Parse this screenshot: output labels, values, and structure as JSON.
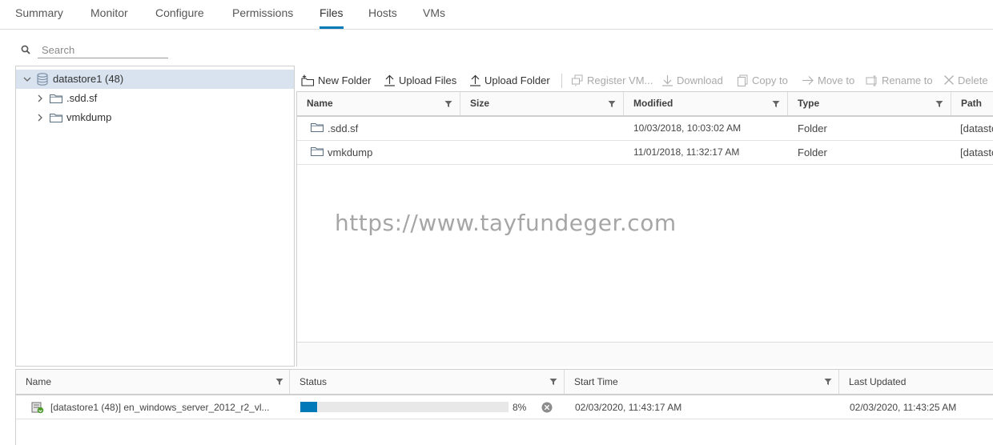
{
  "tabs": [
    {
      "label": "Summary",
      "active": false
    },
    {
      "label": "Monitor",
      "active": false
    },
    {
      "label": "Configure",
      "active": false
    },
    {
      "label": "Permissions",
      "active": false
    },
    {
      "label": "Files",
      "active": true
    },
    {
      "label": "Hosts",
      "active": false
    },
    {
      "label": "VMs",
      "active": false
    }
  ],
  "search": {
    "placeholder": "Search",
    "value": ""
  },
  "tree": {
    "root": {
      "label": "datastore1 (48)",
      "expanded": true,
      "selected": true,
      "icon": "datastore-icon"
    },
    "children": [
      {
        "label": ".sdd.sf",
        "icon": "folder-icon"
      },
      {
        "label": "vmkdump",
        "icon": "folder-icon"
      }
    ]
  },
  "toolbar": {
    "new_folder": "New Folder",
    "upload_files": "Upload Files",
    "upload_folder": "Upload Folder",
    "register_vm": "Register VM...",
    "download": "Download",
    "copy_to": "Copy to",
    "move_to": "Move to",
    "rename_to": "Rename to",
    "delete": "Delete"
  },
  "files": {
    "columns": [
      "Name",
      "Size",
      "Modified",
      "Type",
      "Path"
    ],
    "rows": [
      {
        "name": ".sdd.sf",
        "size": "",
        "modified": "10/03/2018, 10:03:02 AM",
        "type": "Folder",
        "path": "[datasto"
      },
      {
        "name": "vmkdump",
        "size": "",
        "modified": "11/01/2018, 11:32:17 AM",
        "type": "Folder",
        "path": "[datasto"
      }
    ]
  },
  "watermark": "https://www.tayfundeger.com",
  "tasks": {
    "columns": [
      "Name",
      "Status",
      "Start Time",
      "Last Updated"
    ],
    "rows": [
      {
        "name": "[datastore1 (48)] en_windows_server_2012_r2_vl...",
        "progress_fraction": 0.08,
        "progress_text": "8%",
        "start_time": "02/03/2020, 11:43:17 AM",
        "last_updated": "02/03/2020, 11:43:25 AM"
      }
    ]
  },
  "colors": {
    "accent": "#0079b8",
    "selected_row": "#d8e3ef",
    "disabled_text": "#a9a9a9"
  }
}
